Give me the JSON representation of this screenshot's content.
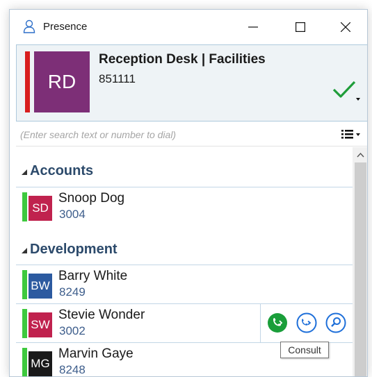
{
  "window": {
    "title": "Presence"
  },
  "user": {
    "initials": "RD",
    "name": "Reception Desk | Facilities",
    "extension": "851111",
    "avatar_color": "#7d2f77",
    "status_color": "#d81e1e",
    "status_icon": "check-icon"
  },
  "search": {
    "placeholder": "(Enter search text or number to dial)",
    "value": ""
  },
  "groups": [
    {
      "name": "Accounts",
      "contacts": [
        {
          "initials": "SD",
          "name": "Snoop Dog",
          "extension": "3004",
          "color": "#c0224e"
        }
      ]
    },
    {
      "name": "Development",
      "contacts": [
        {
          "initials": "BW",
          "name": "Barry White",
          "extension": "8249",
          "color": "#2c5aa0"
        },
        {
          "initials": "SW",
          "name": "Stevie Wonder",
          "extension": "3002",
          "color": "#c0224e"
        },
        {
          "initials": "MG",
          "name": "Marvin Gaye",
          "extension": "8248",
          "color": "#1a1a1a"
        }
      ]
    }
  ],
  "tooltip": "Consult",
  "colors": {
    "presence_available": "#3ec93e",
    "accent_blue": "#1e6fd9",
    "call_green": "#1a9e3a"
  }
}
